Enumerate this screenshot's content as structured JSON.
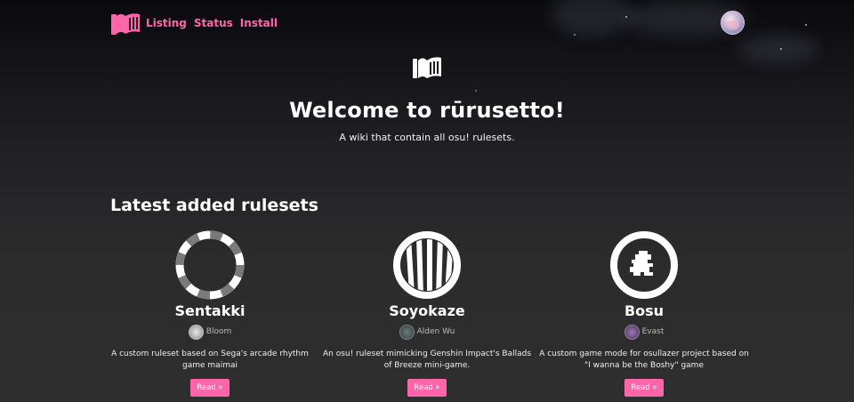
{
  "nav": {
    "links": [
      "Listing",
      "Status",
      "Install"
    ]
  },
  "hero": {
    "title": "Welcome to rūrusetto!",
    "subtitle": "A wiki that contain all osu! rulesets."
  },
  "latest": {
    "title": "Latest added rulesets",
    "cards": [
      {
        "name": "Sentakki",
        "author": "Bloom",
        "description": "A custom ruleset based on Sega's arcade rhythm game maimai",
        "button": "Read »"
      },
      {
        "name": "Soyokaze",
        "author": "Alden Wu",
        "description": "An osu! ruleset mimicking Genshin Impact's Ballads of Breeze mini-game.",
        "button": "Read »"
      },
      {
        "name": "Bosu",
        "author": "Evast",
        "description": "A custom game mode for osullazer project based on \"I wanna be the Boshy\" game",
        "button": "Read »"
      }
    ]
  },
  "colors": {
    "accent": "#ff66aa",
    "background": "#2e2e2e"
  }
}
